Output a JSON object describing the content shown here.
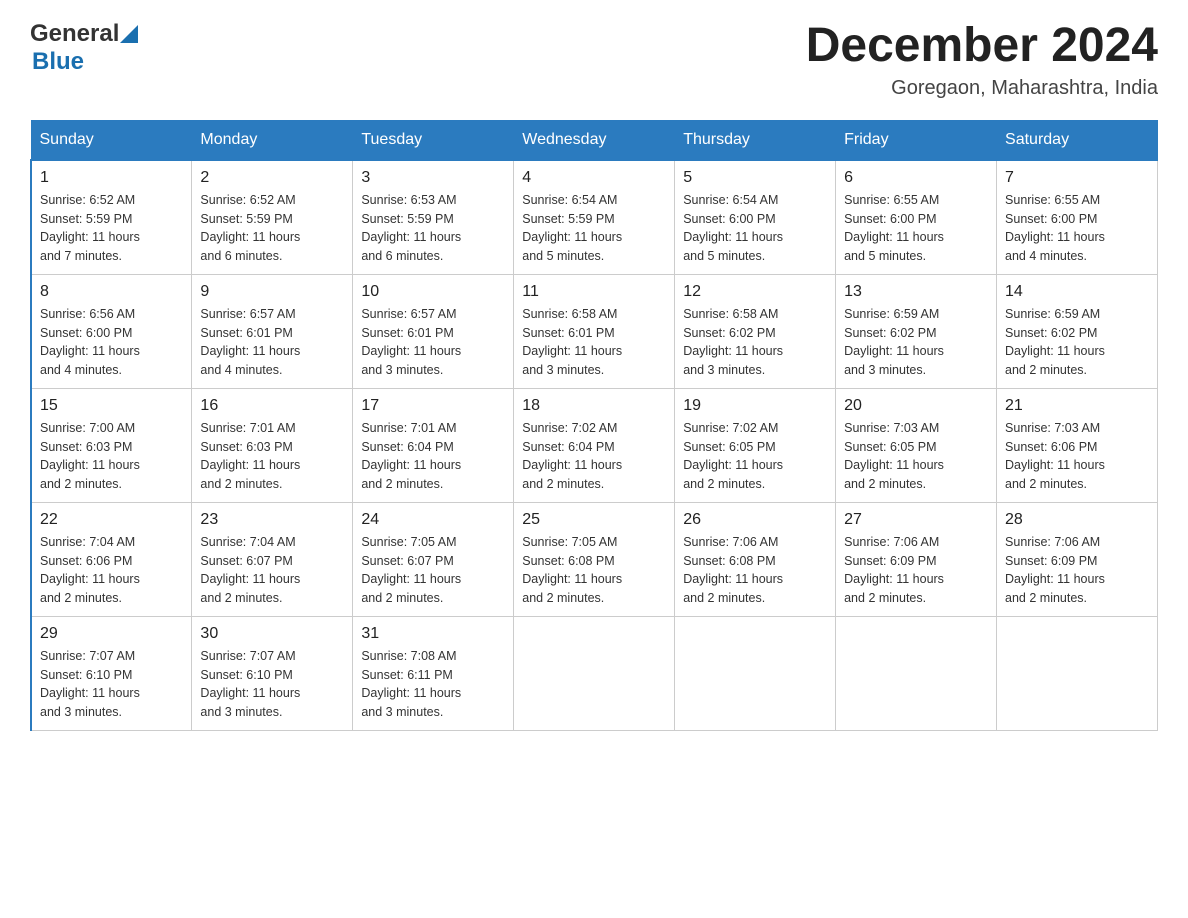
{
  "header": {
    "logo_general": "General",
    "logo_blue": "Blue",
    "month_title": "December 2024",
    "location": "Goregaon, Maharashtra, India"
  },
  "calendar": {
    "days_of_week": [
      "Sunday",
      "Monday",
      "Tuesday",
      "Wednesday",
      "Thursday",
      "Friday",
      "Saturday"
    ],
    "weeks": [
      [
        {
          "day": "1",
          "sunrise": "6:52 AM",
          "sunset": "5:59 PM",
          "daylight": "11 hours and 7 minutes."
        },
        {
          "day": "2",
          "sunrise": "6:52 AM",
          "sunset": "5:59 PM",
          "daylight": "11 hours and 6 minutes."
        },
        {
          "day": "3",
          "sunrise": "6:53 AM",
          "sunset": "5:59 PM",
          "daylight": "11 hours and 6 minutes."
        },
        {
          "day": "4",
          "sunrise": "6:54 AM",
          "sunset": "5:59 PM",
          "daylight": "11 hours and 5 minutes."
        },
        {
          "day": "5",
          "sunrise": "6:54 AM",
          "sunset": "6:00 PM",
          "daylight": "11 hours and 5 minutes."
        },
        {
          "day": "6",
          "sunrise": "6:55 AM",
          "sunset": "6:00 PM",
          "daylight": "11 hours and 5 minutes."
        },
        {
          "day": "7",
          "sunrise": "6:55 AM",
          "sunset": "6:00 PM",
          "daylight": "11 hours and 4 minutes."
        }
      ],
      [
        {
          "day": "8",
          "sunrise": "6:56 AM",
          "sunset": "6:00 PM",
          "daylight": "11 hours and 4 minutes."
        },
        {
          "day": "9",
          "sunrise": "6:57 AM",
          "sunset": "6:01 PM",
          "daylight": "11 hours and 4 minutes."
        },
        {
          "day": "10",
          "sunrise": "6:57 AM",
          "sunset": "6:01 PM",
          "daylight": "11 hours and 3 minutes."
        },
        {
          "day": "11",
          "sunrise": "6:58 AM",
          "sunset": "6:01 PM",
          "daylight": "11 hours and 3 minutes."
        },
        {
          "day": "12",
          "sunrise": "6:58 AM",
          "sunset": "6:02 PM",
          "daylight": "11 hours and 3 minutes."
        },
        {
          "day": "13",
          "sunrise": "6:59 AM",
          "sunset": "6:02 PM",
          "daylight": "11 hours and 3 minutes."
        },
        {
          "day": "14",
          "sunrise": "6:59 AM",
          "sunset": "6:02 PM",
          "daylight": "11 hours and 2 minutes."
        }
      ],
      [
        {
          "day": "15",
          "sunrise": "7:00 AM",
          "sunset": "6:03 PM",
          "daylight": "11 hours and 2 minutes."
        },
        {
          "day": "16",
          "sunrise": "7:01 AM",
          "sunset": "6:03 PM",
          "daylight": "11 hours and 2 minutes."
        },
        {
          "day": "17",
          "sunrise": "7:01 AM",
          "sunset": "6:04 PM",
          "daylight": "11 hours and 2 minutes."
        },
        {
          "day": "18",
          "sunrise": "7:02 AM",
          "sunset": "6:04 PM",
          "daylight": "11 hours and 2 minutes."
        },
        {
          "day": "19",
          "sunrise": "7:02 AM",
          "sunset": "6:05 PM",
          "daylight": "11 hours and 2 minutes."
        },
        {
          "day": "20",
          "sunrise": "7:03 AM",
          "sunset": "6:05 PM",
          "daylight": "11 hours and 2 minutes."
        },
        {
          "day": "21",
          "sunrise": "7:03 AM",
          "sunset": "6:06 PM",
          "daylight": "11 hours and 2 minutes."
        }
      ],
      [
        {
          "day": "22",
          "sunrise": "7:04 AM",
          "sunset": "6:06 PM",
          "daylight": "11 hours and 2 minutes."
        },
        {
          "day": "23",
          "sunrise": "7:04 AM",
          "sunset": "6:07 PM",
          "daylight": "11 hours and 2 minutes."
        },
        {
          "day": "24",
          "sunrise": "7:05 AM",
          "sunset": "6:07 PM",
          "daylight": "11 hours and 2 minutes."
        },
        {
          "day": "25",
          "sunrise": "7:05 AM",
          "sunset": "6:08 PM",
          "daylight": "11 hours and 2 minutes."
        },
        {
          "day": "26",
          "sunrise": "7:06 AM",
          "sunset": "6:08 PM",
          "daylight": "11 hours and 2 minutes."
        },
        {
          "day": "27",
          "sunrise": "7:06 AM",
          "sunset": "6:09 PM",
          "daylight": "11 hours and 2 minutes."
        },
        {
          "day": "28",
          "sunrise": "7:06 AM",
          "sunset": "6:09 PM",
          "daylight": "11 hours and 2 minutes."
        }
      ],
      [
        {
          "day": "29",
          "sunrise": "7:07 AM",
          "sunset": "6:10 PM",
          "daylight": "11 hours and 3 minutes."
        },
        {
          "day": "30",
          "sunrise": "7:07 AM",
          "sunset": "6:10 PM",
          "daylight": "11 hours and 3 minutes."
        },
        {
          "day": "31",
          "sunrise": "7:08 AM",
          "sunset": "6:11 PM",
          "daylight": "11 hours and 3 minutes."
        },
        null,
        null,
        null,
        null
      ]
    ]
  }
}
